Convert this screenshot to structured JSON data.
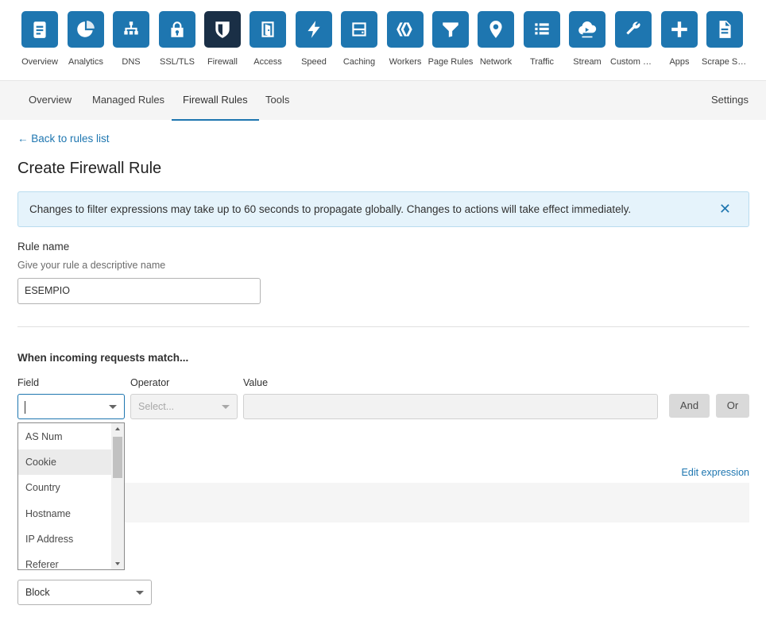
{
  "apps": [
    {
      "name": "overview",
      "label": "Overview",
      "icon": "clipboard-icon"
    },
    {
      "name": "analytics",
      "label": "Analytics",
      "icon": "pie-chart-icon"
    },
    {
      "name": "dns",
      "label": "DNS",
      "icon": "network-tree-icon"
    },
    {
      "name": "ssl-tls",
      "label": "SSL/TLS",
      "icon": "lock-icon"
    },
    {
      "name": "firewall",
      "label": "Firewall",
      "icon": "shield-icon",
      "active": true
    },
    {
      "name": "access",
      "label": "Access",
      "icon": "door-icon"
    },
    {
      "name": "speed",
      "label": "Speed",
      "icon": "lightning-icon"
    },
    {
      "name": "caching",
      "label": "Caching",
      "icon": "drive-icon"
    },
    {
      "name": "workers",
      "label": "Workers",
      "icon": "workers-icon"
    },
    {
      "name": "page-rules",
      "label": "Page Rules",
      "icon": "filter-icon"
    },
    {
      "name": "network",
      "label": "Network",
      "icon": "location-pin-icon"
    },
    {
      "name": "traffic",
      "label": "Traffic",
      "icon": "list-icon"
    },
    {
      "name": "stream",
      "label": "Stream",
      "icon": "cloud-play-icon"
    },
    {
      "name": "custom-pages",
      "label": "Custom Pa...",
      "icon": "wrench-icon"
    },
    {
      "name": "apps",
      "label": "Apps",
      "icon": "plus-icon"
    },
    {
      "name": "scrape-shield",
      "label": "Scrape Shi...",
      "icon": "document-icon"
    }
  ],
  "subnav": {
    "tabs": [
      "Overview",
      "Managed Rules",
      "Firewall Rules",
      "Tools"
    ],
    "active_tab": "Firewall Rules",
    "settings": "Settings"
  },
  "back_link": "← Back to rules list",
  "page_title": "Create Firewall Rule",
  "banner": {
    "message": "Changes to filter expressions may take up to 60 seconds to propagate globally. Changes to actions will take effect immediately.",
    "close": "✕"
  },
  "rule_name": {
    "label": "Rule name",
    "hint": "Give your rule a descriptive name",
    "value": "ESEMPIO"
  },
  "match": {
    "title": "When incoming requests match...",
    "field_label": "Field",
    "operator_label": "Operator",
    "value_label": "Value",
    "field_value": "",
    "operator_placeholder": "Select...",
    "value": "",
    "and_button": "And",
    "or_button": "Or",
    "edit_expression": "Edit expression"
  },
  "field_dropdown": {
    "options": [
      "AS Num",
      "Cookie",
      "Country",
      "Hostname",
      "IP Address",
      "Referer"
    ],
    "highlighted": "Cookie"
  },
  "action": {
    "value": "Block"
  },
  "colors": {
    "accent": "#1e76b0",
    "active_tile": "#1a2f46",
    "banner_bg": "#e5f3fb"
  }
}
